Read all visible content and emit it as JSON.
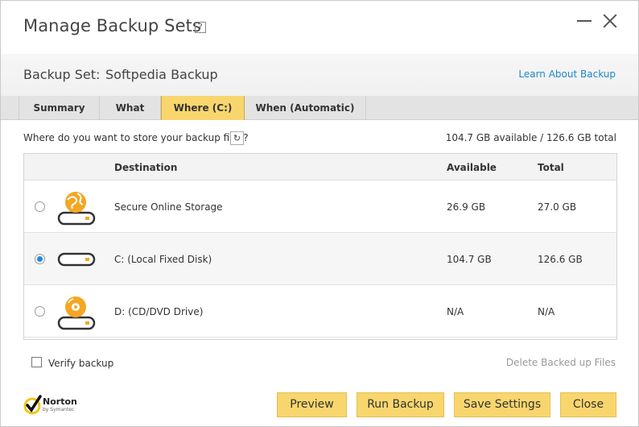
{
  "window": {
    "title": "Manage Backup Sets",
    "help_badge": "?"
  },
  "setbar": {
    "label": "Backup Set:",
    "value": "Softpedia Backup",
    "learn_link": "Learn About Backup"
  },
  "tabs": [
    {
      "label": "Summary",
      "active": false
    },
    {
      "label": "What",
      "active": false
    },
    {
      "label": "Where (C:)",
      "active": true
    },
    {
      "label": "When (Automatic)",
      "active": false
    }
  ],
  "question": "Where do you want to store your backup files?",
  "space_total": "104.7 GB available / 126.6 GB total",
  "table": {
    "headers": {
      "destination": "Destination",
      "available": "Available",
      "total": "Total"
    },
    "rows": [
      {
        "icon": "online-storage-icon",
        "destination": "Secure Online Storage",
        "available": "26.9 GB",
        "total": "27.0 GB",
        "selected": false
      },
      {
        "icon": "hard-disk-icon",
        "destination": "C: (Local Fixed Disk)",
        "available": "104.7 GB",
        "total": "126.6 GB",
        "selected": true
      },
      {
        "icon": "cd-dvd-drive-icon",
        "destination": "D: (CD/DVD Drive)",
        "available": "N/A",
        "total": "N/A",
        "selected": false
      }
    ]
  },
  "footer": {
    "verify_label": "Verify backup",
    "verify_checked": false,
    "delete_link": "Delete Backed up Files",
    "logo_name": "Norton",
    "logo_sub": "by Symantec",
    "buttons": {
      "preview": "Preview",
      "run": "Run Backup",
      "save": "Save Settings",
      "close": "Close"
    }
  },
  "colors": {
    "accent": "#f9d66d",
    "link": "#1e88c9",
    "radio_selected": "#1e88e5",
    "icon_orange": "#f5a623"
  }
}
